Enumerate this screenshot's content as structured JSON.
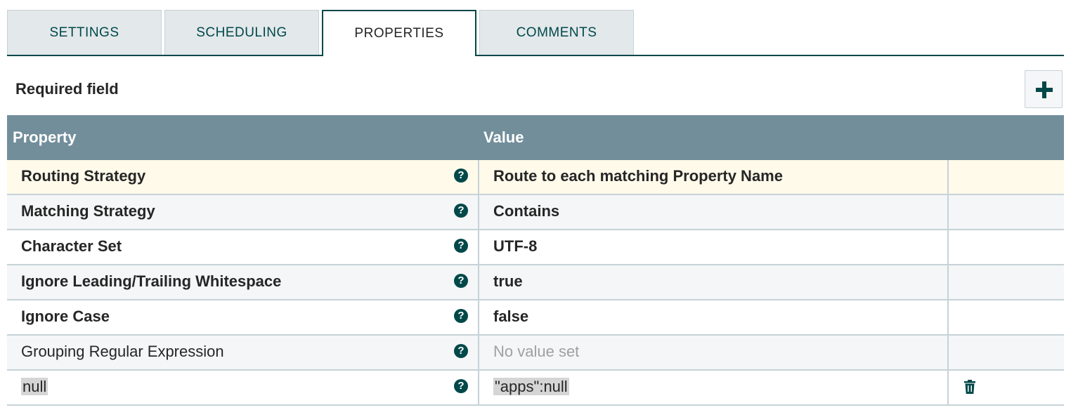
{
  "tabs": [
    {
      "label": "SETTINGS",
      "active": false
    },
    {
      "label": "SCHEDULING",
      "active": false
    },
    {
      "label": "PROPERTIES",
      "active": true
    },
    {
      "label": "COMMENTS",
      "active": false
    }
  ],
  "required_label": "Required field",
  "add_button_icon": "plus-icon",
  "table": {
    "headers": {
      "property": "Property",
      "value": "Value"
    },
    "rows": [
      {
        "property": "Routing Strategy",
        "value": "Route to each matching Property Name",
        "required": true
      },
      {
        "property": "Matching Strategy",
        "value": "Contains",
        "required": true
      },
      {
        "property": "Character Set",
        "value": "UTF-8",
        "required": true
      },
      {
        "property": "Ignore Leading/Trailing Whitespace",
        "value": "true",
        "required": true
      },
      {
        "property": "Ignore Case",
        "value": "false",
        "required": true
      },
      {
        "property": "Grouping Regular Expression",
        "value": "No value set",
        "required": false
      },
      {
        "property": "null",
        "value": "\"apps\":null",
        "required": false,
        "deletable": true
      }
    ]
  },
  "colors": {
    "accent": "#004849",
    "header_bg": "#728e9b",
    "selected_row": "#fffaea",
    "tab_bg": "#e3e8eb"
  }
}
